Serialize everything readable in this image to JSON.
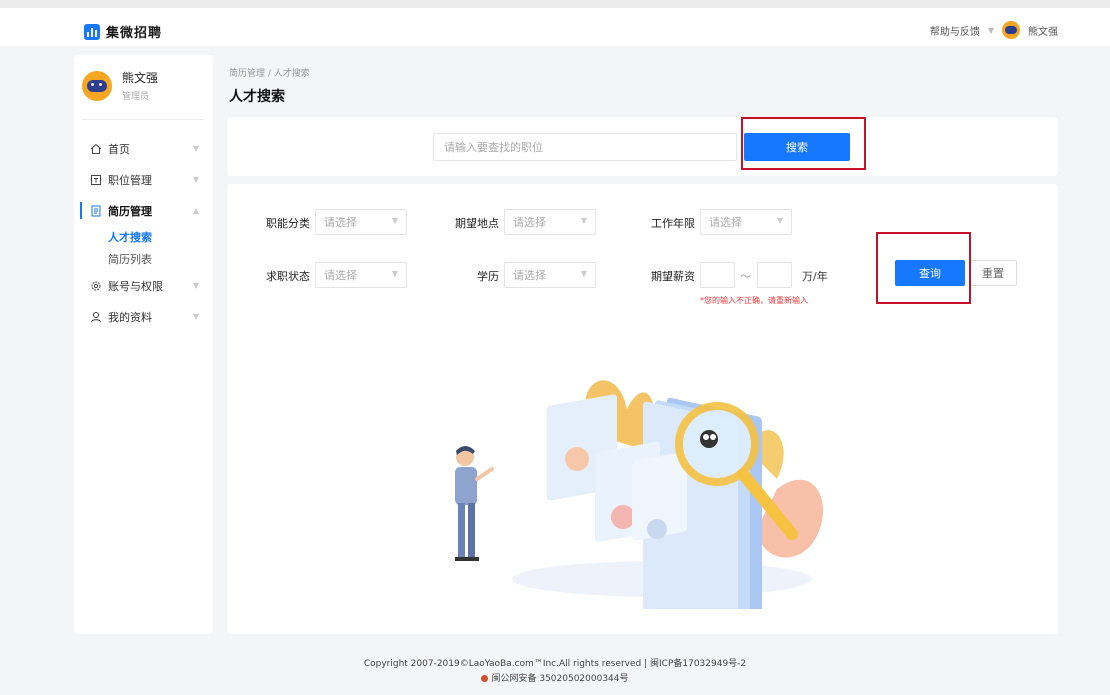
{
  "app": {
    "name": "集微招聘"
  },
  "topbar": {
    "help_label": "帮助与反馈",
    "user_name": "熊文强"
  },
  "sidebar": {
    "user": {
      "name": "熊文强",
      "role": "管理员"
    },
    "items": [
      {
        "label": "首页",
        "icon": "home-icon"
      },
      {
        "label": "职位管理",
        "icon": "position-icon"
      },
      {
        "label": "简历管理",
        "icon": "resume-icon",
        "expanded": true,
        "children": [
          {
            "label": "人才搜索",
            "active": true
          },
          {
            "label": "简历列表"
          }
        ]
      },
      {
        "label": "账号与权限",
        "icon": "gear-icon"
      },
      {
        "label": "我的资料",
        "icon": "user-icon"
      }
    ]
  },
  "breadcrumb": "简历管理 / 人才搜索",
  "page_title": "人才搜索",
  "search": {
    "placeholder": "请输入要查找的职位",
    "button": "搜索"
  },
  "filters": {
    "function_label": "职能分类",
    "function_placeholder": "请选择",
    "location_label": "期望地点",
    "location_placeholder": "请选择",
    "experience_label": "工作年限",
    "experience_placeholder": "请选择",
    "status_label": "求职状态",
    "status_placeholder": "请选择",
    "education_label": "学历",
    "education_placeholder": "请选择",
    "salary_label": "期望薪资",
    "salary_separator": "～",
    "salary_unit": "万/年",
    "salary_error": "*您的输入不正确，请重新输入",
    "query_button": "查询",
    "reset_button": "重置"
  },
  "footer": {
    "copyright": "Copyright 2007-2019©LaoYaoBa.com™Inc.All rights reserved | 闽ICP备17032949号-2",
    "police": "闽公网安备 35020502000344号"
  },
  "colors": {
    "accent": "#1677ff",
    "highlight": "#c8102e",
    "error": "#e8383d"
  }
}
